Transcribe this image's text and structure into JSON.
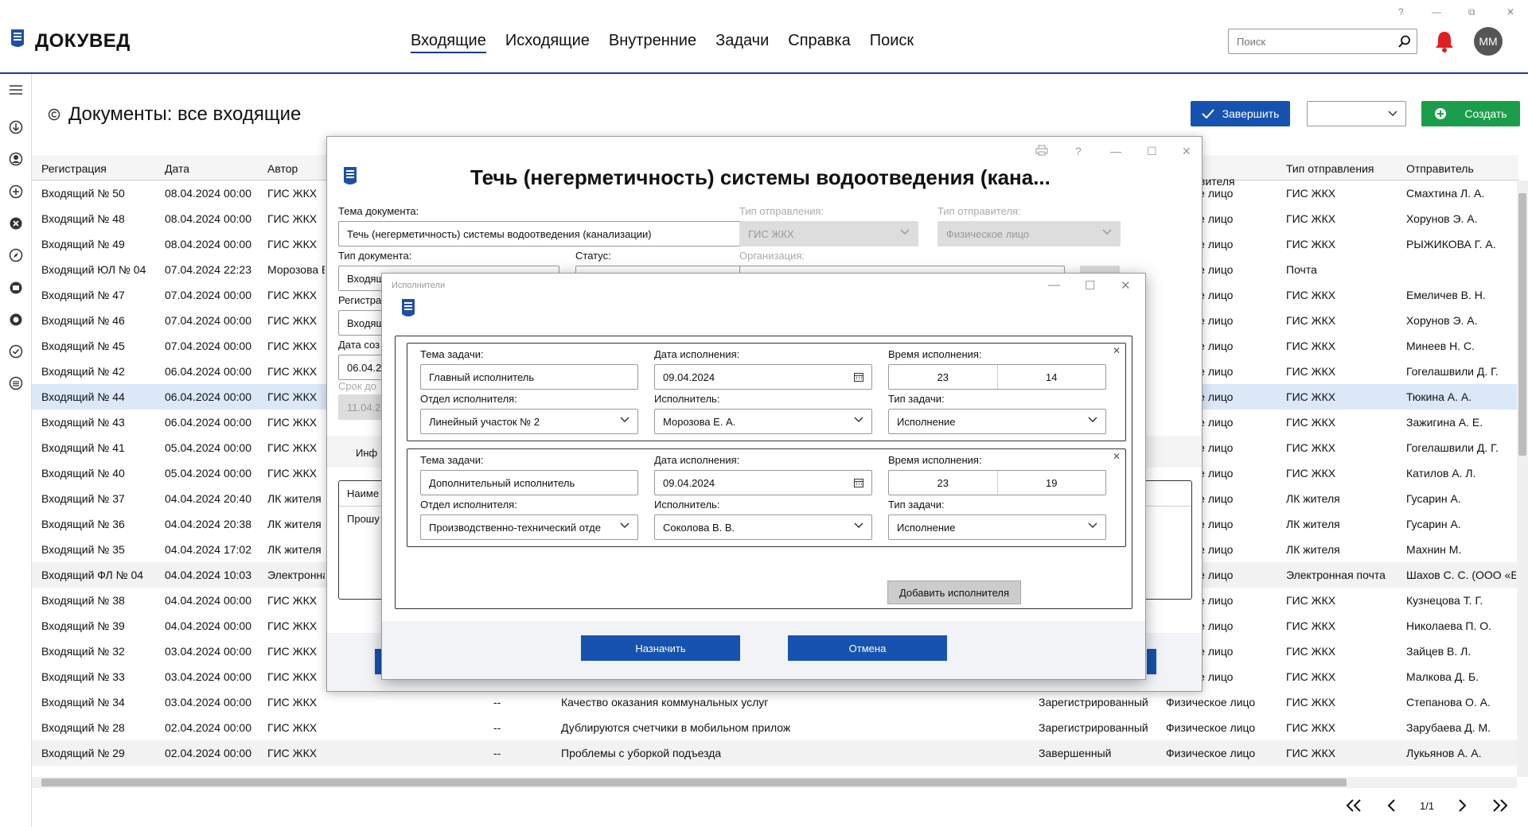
{
  "app": {
    "name": "ДОКУВЕД"
  },
  "window_controls": [
    "?",
    "—",
    "⧉",
    "✕"
  ],
  "nav": {
    "items": [
      "Входящие",
      "Исходящие",
      "Внутренние",
      "Задачи",
      "Справка",
      "Поиск"
    ]
  },
  "search": {
    "placeholder": "Поиск"
  },
  "user": {
    "initials": "ММ"
  },
  "page": {
    "title": "Документы: все входящие"
  },
  "toolbar": {
    "finish_label": "Завершить",
    "create_label": "Создать"
  },
  "table": {
    "columns": {
      "reg": "Регистрация",
      "date": "Дата",
      "author": "Автор",
      "sender_type": "Тип отправителя",
      "send_type": "Тип отправления",
      "sender": "Отправитель"
    },
    "rows": [
      {
        "reg": "Входящий № 50",
        "date": "08.04.2024 00:00",
        "author": "ГИС ЖКХ",
        "stype": "ческое лицо",
        "send": "ГИС ЖКХ",
        "sender": "Смахтина Л. А."
      },
      {
        "reg": "Входящий № 48",
        "date": "08.04.2024 00:00",
        "author": "ГИС ЖКХ",
        "stype": "ческое лицо",
        "send": "ГИС ЖКХ",
        "sender": "Хорунов Э. А."
      },
      {
        "reg": "Входящий № 49",
        "date": "08.04.2024 00:00",
        "author": "ГИС ЖКХ",
        "stype": "ческое лицо",
        "send": "ГИС ЖКХ",
        "sender": "РЫЖИКОВА Г. А."
      },
      {
        "reg": "Входящий ЮЛ № 04",
        "date": "07.04.2024 22:23",
        "author": "Морозова Е",
        "stype": "ческое лицо",
        "send": "Почта",
        "sender": ""
      },
      {
        "reg": "Входящий № 47",
        "date": "07.04.2024 00:00",
        "author": "ГИС ЖКХ",
        "stype": "ческое лицо",
        "send": "ГИС ЖКХ",
        "sender": "Емеличев В. Н."
      },
      {
        "reg": "Входящий № 46",
        "date": "07.04.2024 00:00",
        "author": "ГИС ЖКХ",
        "stype": "ческое лицо",
        "send": "ГИС ЖКХ",
        "sender": "Хорунов Э. А."
      },
      {
        "reg": "Входящий № 45",
        "date": "07.04.2024 00:00",
        "author": "ГИС ЖКХ",
        "stype": "ческое лицо",
        "send": "ГИС ЖКХ",
        "sender": "Минеев Н. С."
      },
      {
        "reg": "Входящий № 42",
        "date": "06.04.2024 00:00",
        "author": "ГИС ЖКХ",
        "stype": "ческое лицо",
        "send": "ГИС ЖКХ",
        "sender": "Гогелашвили Д. Г."
      },
      {
        "reg": "Входящий № 44",
        "date": "06.04.2024 00:00",
        "author": "ГИС ЖКХ",
        "stype": "ческое лицо",
        "send": "ГИС ЖКХ",
        "sender": "Тюкина А. А."
      },
      {
        "reg": "Входящий № 43",
        "date": "06.04.2024 00:00",
        "author": "ГИС ЖКХ",
        "stype": "ческое лицо",
        "send": "ГИС ЖКХ",
        "sender": "Зажигина А. Е."
      },
      {
        "reg": "Входящий № 41",
        "date": "05.04.2024 00:00",
        "author": "ГИС ЖКХ",
        "stype": "ческое лицо",
        "send": "ГИС ЖКХ",
        "sender": "Гогелашвили Д. Г."
      },
      {
        "reg": "Входящий № 40",
        "date": "05.04.2024 00:00",
        "author": "ГИС ЖКХ",
        "stype": "ческое лицо",
        "send": "ГИС ЖКХ",
        "sender": "Катилов А. Л."
      },
      {
        "reg": "Входящий № 37",
        "date": "04.04.2024 20:40",
        "author": "ЛК жителя",
        "stype": "ческое лицо",
        "send": "ЛК жителя",
        "sender": "Гусарин А."
      },
      {
        "reg": "Входящий № 36",
        "date": "04.04.2024 20:38",
        "author": "ЛК жителя",
        "stype": "ческое лицо",
        "send": "ЛК жителя",
        "sender": "Гусарин А."
      },
      {
        "reg": "Входящий № 35",
        "date": "04.04.2024 17:02",
        "author": "ЛК жителя",
        "stype": "ческое лицо",
        "send": "ЛК жителя",
        "sender": "Махнин М."
      },
      {
        "reg": "Входящий ФЛ № 04",
        "date": "04.04.2024 10:03",
        "author": "Электронна",
        "stype": "ческое лицо",
        "send": "Электронная почта",
        "sender": "Шахов С. С. (ООО «Б"
      },
      {
        "reg": "Входящий № 38",
        "date": "04.04.2024 00:00",
        "author": "ГИС ЖКХ",
        "stype": "ческое лицо",
        "send": "ГИС ЖКХ",
        "sender": "Кузнецова Т. Г."
      },
      {
        "reg": "Входящий № 39",
        "date": "04.04.2024 00:00",
        "author": "ГИС ЖКХ",
        "stype": "ческое лицо",
        "send": "ГИС ЖКХ",
        "sender": "Николаева П. О."
      },
      {
        "reg": "Входящий № 32",
        "date": "03.04.2024 00:00",
        "author": "ГИС ЖКХ",
        "stype": "ческое лицо",
        "send": "ГИС ЖКХ",
        "sender": "Зайцев В. Л."
      },
      {
        "reg": "Входящий № 33",
        "date": "03.04.2024 00:00",
        "author": "ГИС ЖКХ",
        "stype": "ческое лицо",
        "send": "ГИС ЖКХ",
        "sender": "Малкова Д. Б."
      },
      {
        "reg": "Входящий № 34",
        "date": "03.04.2024 00:00",
        "author": "ГИС ЖКХ",
        "dash": "--",
        "subject": "Качество оказания коммунальных услуг",
        "status": "Зарегистрированный",
        "stype": "Физическое лицо",
        "send": "ГИС ЖКХ",
        "sender": "Степанова О. А."
      },
      {
        "reg": "Входящий № 28",
        "date": "02.04.2024 00:00",
        "author": "ГИС ЖКХ",
        "dash": "--",
        "subject": "Дублируются счетчики в мобильном прилож",
        "status": "Зарегистрированный",
        "stype": "Физическое лицо",
        "send": "ГИС ЖКХ",
        "sender": "Зарубаева Д. М."
      },
      {
        "reg": "Входящий № 29",
        "date": "02.04.2024 00:00",
        "author": "ГИС ЖКХ",
        "dash": "--",
        "subject": "Проблемы с уборкой подъезда",
        "status": "Завершенный",
        "stype": "Физическое лицо",
        "send": "ГИС ЖКХ",
        "sender": "Лукьянов А. А."
      }
    ]
  },
  "pager": {
    "text": "1/1"
  },
  "doc": {
    "title": "Течь (негерметичность) системы водоотведения (кана...",
    "topic_label": "Тема документа:",
    "topic_value": "Течь (негерметичность) системы водоотведения (канализации)",
    "send_type_label": "Тип отправления:",
    "send_type_value": "ГИС ЖКХ",
    "sender_type_label": "Тип отправителя:",
    "sender_type_value": "Физическое лицо",
    "doc_type_label": "Тип документа:",
    "doc_type_value": "Входящ",
    "status_label": "Статус:",
    "org_label": "Организация:",
    "reg_label": "Регистра",
    "reg_value": "Входящ",
    "created_label": "Дата соз",
    "created_value": "06.04.2",
    "due_label": "Срок до",
    "due_value": "11.04.2",
    "info_tab": "Инф",
    "name_header": "Наиме",
    "body_text": "Прошу"
  },
  "modal": {
    "title": "Исполнители",
    "tasks": [
      {
        "topic_label": "Тема задачи:",
        "topic": "Главный исполнитель",
        "date_label": "Дата исполнения:",
        "date": "09.04.2024",
        "time_label": "Время исполнения:",
        "hour": "23",
        "minute": "14",
        "dept_label": "Отдел исполнителя:",
        "dept": "Линейный участок № 2",
        "exec_label": "Исполнитель:",
        "exec": "Морозова Е. А.",
        "type_label": "Тип задачи:",
        "type": "Исполнение"
      },
      {
        "topic_label": "Тема задачи:",
        "topic": "Дополнительный исполнитель",
        "date_label": "Дата исполнения:",
        "date": "09.04.2024",
        "time_label": "Время исполнения:",
        "hour": "23",
        "minute": "19",
        "dept_label": "Отдел исполнителя:",
        "dept": "Производственно-технический отде",
        "exec_label": "Исполнитель:",
        "exec": "Соколова В. В.",
        "type_label": "Тип задачи:",
        "type": "Исполнение"
      }
    ],
    "add_label": "Добавить исполнителя",
    "assign_label": "Назначить",
    "cancel_label": "Отмена"
  },
  "colors": {
    "primary": "#1652b0",
    "create": "#1b9e4b",
    "bell": "#e02020",
    "selected_row": "#dbe8f7"
  }
}
